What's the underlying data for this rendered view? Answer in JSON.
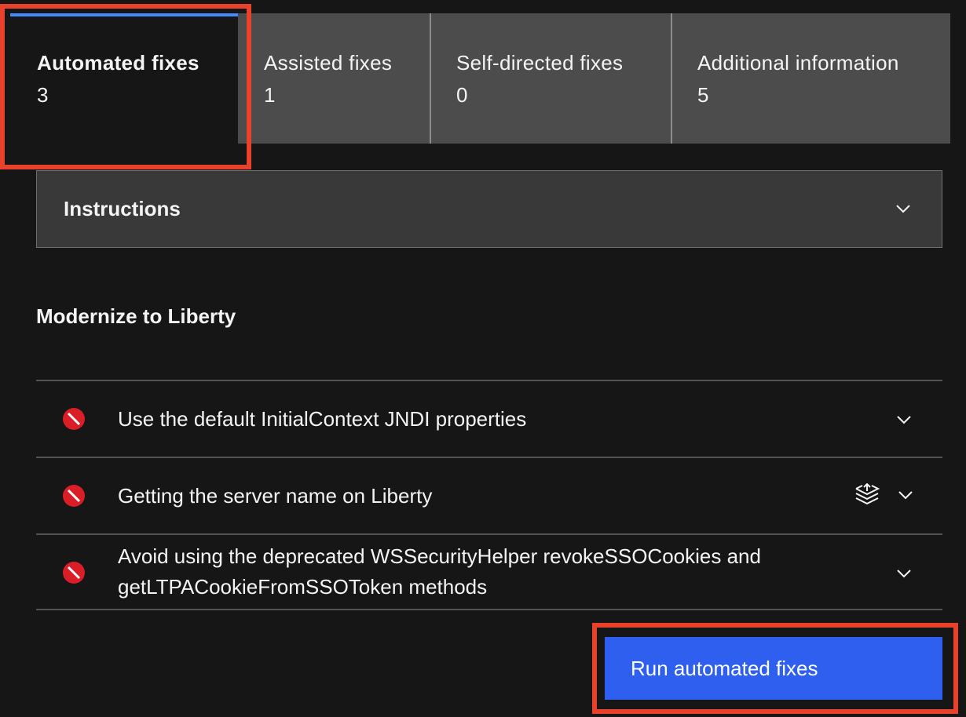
{
  "tabs": [
    {
      "label": "Automated fixes",
      "count": "3",
      "active": true
    },
    {
      "label": "Assisted fixes",
      "count": "1",
      "active": false
    },
    {
      "label": "Self-directed fixes",
      "count": "0",
      "active": false
    },
    {
      "label": "Additional information",
      "count": "5",
      "active": false
    }
  ],
  "instructions": {
    "title": "Instructions",
    "icon": "chevron-down-icon"
  },
  "section": {
    "title": "Modernize to Liberty"
  },
  "issues": [
    {
      "text": "Use the default InitialContext JNDI properties",
      "icon": "blocked-icon",
      "has_layers_icon": false
    },
    {
      "text": "Getting the server name on Liberty",
      "icon": "blocked-icon",
      "has_layers_icon": true
    },
    {
      "text": "Avoid using the deprecated WSSecurityHelper revokeSSOCookies and getLTPACookieFromSSOToken methods",
      "icon": "blocked-icon",
      "has_layers_icon": false
    }
  ],
  "run_button": {
    "label": "Run automated fixes"
  },
  "colors": {
    "background": "#161616",
    "tab_inactive": "#4c4c4c",
    "tab_active_indicator": "#4589ff",
    "error_icon": "#da1e28",
    "primary_button": "#2f5fef",
    "highlight_box": "#e8412c"
  }
}
